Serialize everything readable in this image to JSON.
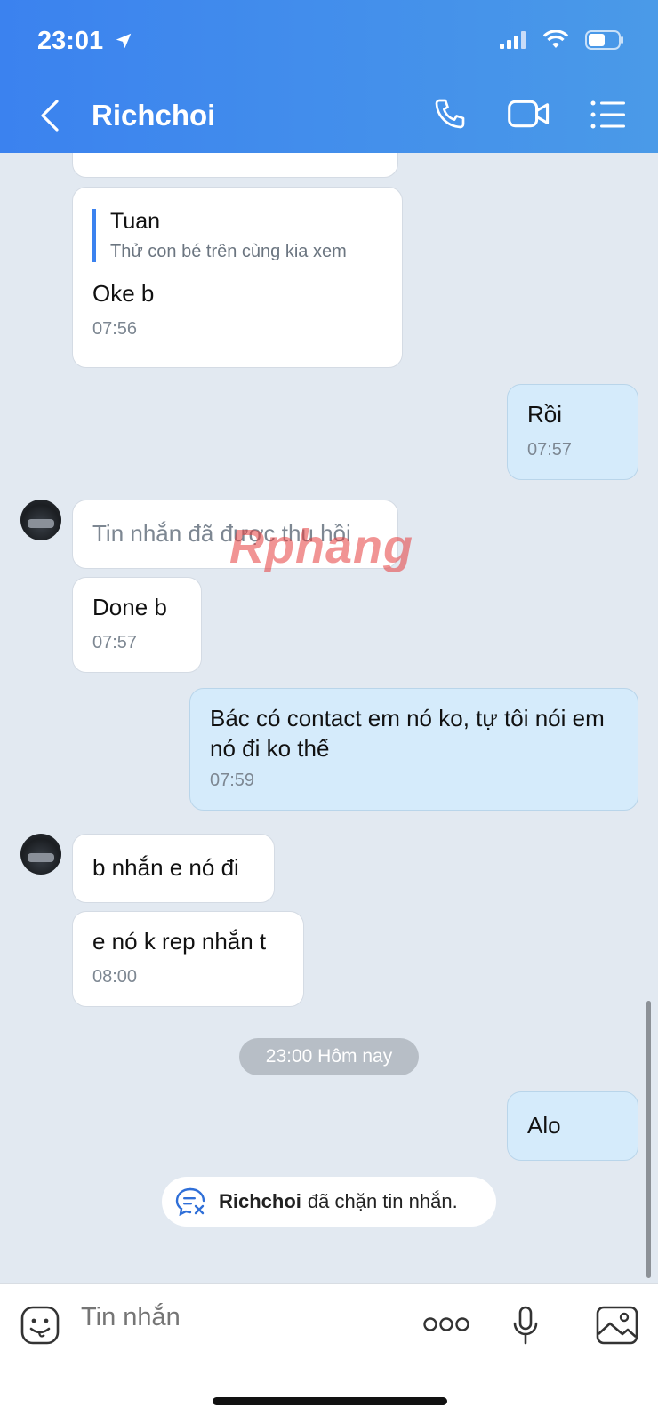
{
  "status_bar": {
    "time": "23:01"
  },
  "header": {
    "title": "Richchoi"
  },
  "messages": {
    "m1": {
      "quote_name": "Tuan",
      "quote_text": "Thử con bé trên cùng kia xem",
      "text": "Oke b",
      "time": "07:56"
    },
    "m2": {
      "text": "Rồi",
      "time": "07:57"
    },
    "m3": {
      "text": "Tin nhắn đã được thu hồi"
    },
    "m4": {
      "text": "Done b",
      "time": "07:57"
    },
    "m5": {
      "text": "Bác có contact em nó ko, tự tôi nói em nó đi ko thế",
      "time": "07:59"
    },
    "m6": {
      "text": "b nhắn e nó đi"
    },
    "m7": {
      "text": "e nó k rep nhắn t",
      "time": "08:00"
    },
    "m8": {
      "text": "Alo"
    }
  },
  "date_separator": "23:00 Hôm nay",
  "blocked_notice": {
    "name": "Richchoi",
    "text": "đã chặn tin nhắn."
  },
  "composer": {
    "placeholder": "Tin nhắn"
  },
  "watermark": "Rphang",
  "colors": {
    "header": "#3b82ef",
    "sent_bubble": "#d5ebfb",
    "background": "#e2e9f1"
  }
}
